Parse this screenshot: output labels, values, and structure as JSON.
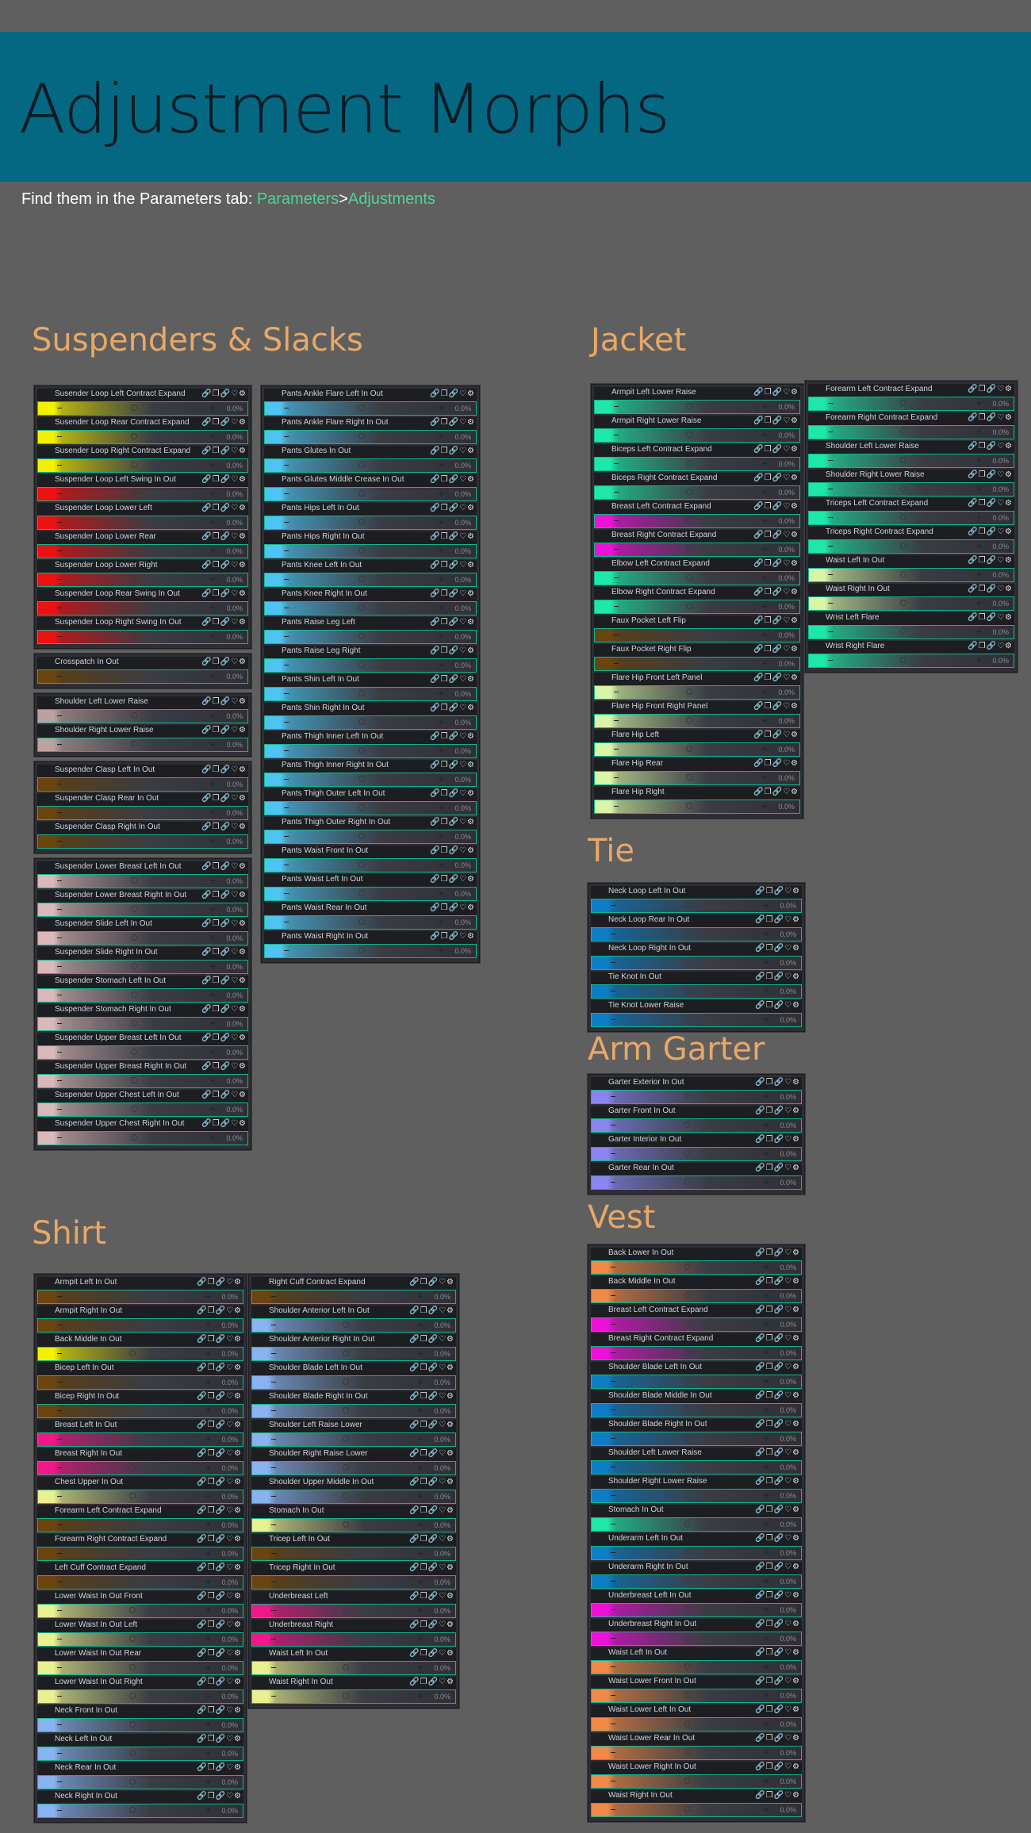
{
  "header": {
    "title": "Adjustment Morphs",
    "instruction": "Find them in the Parameters tab: ",
    "path_1": "Parameters",
    "path_sep": ">",
    "path_2": "Adjustments"
  },
  "colors": {
    "banner": "#046882",
    "section_title": "#e8a866",
    "link": "#4fd39a",
    "slider_border": "#12b58e"
  },
  "row_icons": "link-icon, layers-icon, chain-icon, heart-icon, gear-icon",
  "slider_value": "0.0%",
  "sections": [
    {
      "title": "Suspenders & Slacks",
      "panels": [
        {
          "color": "#f2f200",
          "rows": [
            "Susender Loop Left Contract Expand",
            "Susender Loop Rear Contract Expand",
            "Susender Loop Right Contract Expand"
          ]
        },
        {
          "color": "#ee1111",
          "rows": [
            "Suspender Loop Left Swing In Out",
            "Suspender Loop Lower Left",
            "Suspender Loop Lower Rear",
            "Suspender Loop Lower Right",
            "Suspender Loop Rear Swing In Out",
            "Suspender Loop Right Swing In Out"
          ]
        },
        {
          "color": "#6b4510",
          "rows": [
            "Crosspatch In Out"
          ]
        },
        {
          "color": "#b9a2a0",
          "rows": [
            "Shoulder Left Lower Raise",
            "Shoulder Right Lower Raise"
          ]
        },
        {
          "color": "#6b4510",
          "rows": [
            "Suspender Clasp Left In Out",
            "Suspender Clasp Rear In Out",
            "Suspender Clasp Right In Out"
          ]
        },
        {
          "color": "#d8b8b8",
          "rows": [
            "Suspender Lower Breast Left In Out",
            "Suspender Lower Breast Right In Out",
            "Suspender Slide Left In Out",
            "Suspender Slide Right In Out",
            "Suspender Stomach Left In Out",
            "Suspender Stomach Right In Out",
            "Suspender Upper Breast Left In Out",
            "Suspender Upper Breast Right In Out",
            "Suspender Upper Chest Left In Out",
            "Suspender Upper Chest Right In Out"
          ]
        },
        {
          "color": "#4ec4f2",
          "rows": [
            "Pants Ankle Flare Left In Out",
            "Pants Ankle Flare Right In Out",
            "Pants Glutes In Out",
            "Pants Glutes Middle Crease In Out",
            "Pants Hips Left In Out",
            "Pants Hips Right In Out",
            "Pants Knee Left In Out",
            "Pants Knee Right In Out",
            "Pants Raise Leg Left",
            "Pants Raise Leg Right",
            "Pants Shin Left In Out",
            "Pants Shin Right In Out",
            "Pants Thigh Inner Left In Out",
            "Pants Thigh Inner Right In Out",
            "Pants Thigh Outer Left In Out",
            "Pants Thigh Outer Right In Out",
            "Pants Waist Front In Out",
            "Pants Waist Left In Out",
            "Pants Waist Rear In Out",
            "Pants Waist Right In Out"
          ]
        }
      ]
    },
    {
      "title": "Jacket",
      "panels": [
        {
          "color": "#1ee8a8",
          "rows": [
            "Armpit Left Lower Raise",
            "Armpit Right Lower Raise",
            "Biceps Left Contract Expand",
            "Biceps Right Contract Expand"
          ]
        },
        {
          "color": "#ee11d8",
          "rows": [
            "Breast Left Contract Expand",
            "Breast Right Contract Expand"
          ]
        },
        {
          "color": "#1ee8a8",
          "rows": [
            "Elbow Left Contract Expand",
            "Elbow Right Contract Expand"
          ]
        },
        {
          "color": "#6b4510",
          "rows": [
            "Faux Pocket Left Flip",
            "Faux Pocket Right Flip"
          ]
        },
        {
          "color": "#d8f5a8",
          "rows": [
            "Flare Hip Front Left Panel",
            "Flare Hip Front Right Panel",
            "Flare Hip Left",
            "Flare Hip Rear",
            "Flare Hip Right"
          ]
        },
        {
          "color": "#1ee8a8",
          "rows": [
            "Forearm Left Contract Expand",
            "Forearm Right Contract Expand",
            "Shoulder Left Lower Raise",
            "Shoulder Right Lower Raise",
            "Triceps Left Contract Expand",
            "Triceps Right Contract Expand"
          ]
        },
        {
          "color": "#d8f5a8",
          "rows": [
            "Waist Left In Out",
            "Waist Right In Out"
          ]
        },
        {
          "color": "#1ee8a8",
          "rows": [
            "Wrist Left Flare",
            "Wrist Right Flare"
          ]
        }
      ]
    },
    {
      "title": "Tie",
      "panels": [
        {
          "color": "#0d7dc4",
          "rows": [
            "Neck Loop Left In Out",
            "Neck Loop Rear In Out",
            "Neck Loop Right In Out",
            "Tie Knot In Out",
            "Tie Knot Lower Raise"
          ]
        }
      ]
    },
    {
      "title": "Arm Garter",
      "panels": [
        {
          "color": "#8a86f0",
          "rows": [
            "Garter Exterior In Out",
            "Garter Front In Out",
            "Garter Interior In Out",
            "Garter Rear In Out"
          ]
        }
      ]
    },
    {
      "title": "Shirt",
      "panels": [
        {
          "color": "#6b4510",
          "rows": [
            "Armpit Left In Out",
            "Armpit Right In Out"
          ]
        },
        {
          "color": "#f2f200",
          "rows": [
            "Back Middle In Out"
          ]
        },
        {
          "color": "#6b4510",
          "rows": [
            "Bicep Left In Out",
            "Bicep Right In Out"
          ]
        },
        {
          "color": "#f01888",
          "rows": [
            "Breast Left In Out",
            "Breast Right In Out"
          ]
        },
        {
          "color": "#e8f090",
          "rows": [
            "Chest Upper In Out"
          ]
        },
        {
          "color": "#6b4510",
          "rows": [
            "Forearm Left Contract Expand",
            "Forearm Right Contract Expand",
            "Left Cuff Contract Expand"
          ]
        },
        {
          "color": "#e8f090",
          "rows": [
            "Lower Waist In Out Front",
            "Lower Waist In Out Left",
            "Lower Waist In Out Rear",
            "Lower Waist In Out Right"
          ]
        },
        {
          "color": "#88b2f0",
          "rows": [
            "Neck Front In Out",
            "Neck Left In Out",
            "Neck Rear In Out",
            "Neck Right In Out"
          ]
        },
        {
          "color": "#6b4510",
          "rows": [
            "Right Cuff Contract Expand"
          ]
        },
        {
          "color": "#88b2f0",
          "rows": [
            "Shoulder Anterior Left In Out",
            "Shoulder Anterior Right In Out",
            "Shoulder Blade Left In Out",
            "Shoulder Blade Right In Out",
            "Shoulder Left Raise Lower",
            "Shoulder Right Raise Lower",
            "Shoulder Upper Middle In Out"
          ]
        },
        {
          "color": "#e8f090",
          "rows": [
            "Stomach In Out"
          ]
        },
        {
          "color": "#6b4510",
          "rows": [
            "Tricep Left In Out",
            "Tricep Right In Out"
          ]
        },
        {
          "color": "#f01888",
          "rows": [
            "Underbreast Left",
            "Underbreast Right"
          ]
        },
        {
          "color": "#e8f090",
          "rows": [
            "Waist Left In Out",
            "Waist Right In Out"
          ]
        }
      ]
    },
    {
      "title": "Vest",
      "panels": [
        {
          "color": "#f08a48",
          "rows": [
            "Back Lower In Out",
            "Back Middle In Out"
          ]
        },
        {
          "color": "#ee11d8",
          "rows": [
            "Breast Left Contract Expand",
            "Breast Right Contract Expand"
          ]
        },
        {
          "color": "#0d7dc4",
          "rows": [
            "Shoulder Blade Left In Out",
            "Shoulder Blade Middle In Out",
            "Shoulder Blade Right In Out",
            "Shoulder Left Lower Raise",
            "Shoulder Right Lower Raise"
          ]
        },
        {
          "color": "#1ee8a8",
          "rows": [
            "Stomach In Out"
          ]
        },
        {
          "color": "#0d7dc4",
          "rows": [
            "Underarm Left In Out",
            "Underarm Right In Out"
          ]
        },
        {
          "color": "#ee11d8",
          "rows": [
            "Underbreast Left In Out",
            "Underbreast Right In Out"
          ]
        },
        {
          "color": "#f08a48",
          "rows": [
            "Waist Left In Out",
            "Waist Lower Front In Out",
            "Waist Lower Left In Out",
            "Waist Lower Rear In Out",
            "Waist Lower Right In Out",
            "Waist Right In Out"
          ]
        }
      ]
    }
  ]
}
